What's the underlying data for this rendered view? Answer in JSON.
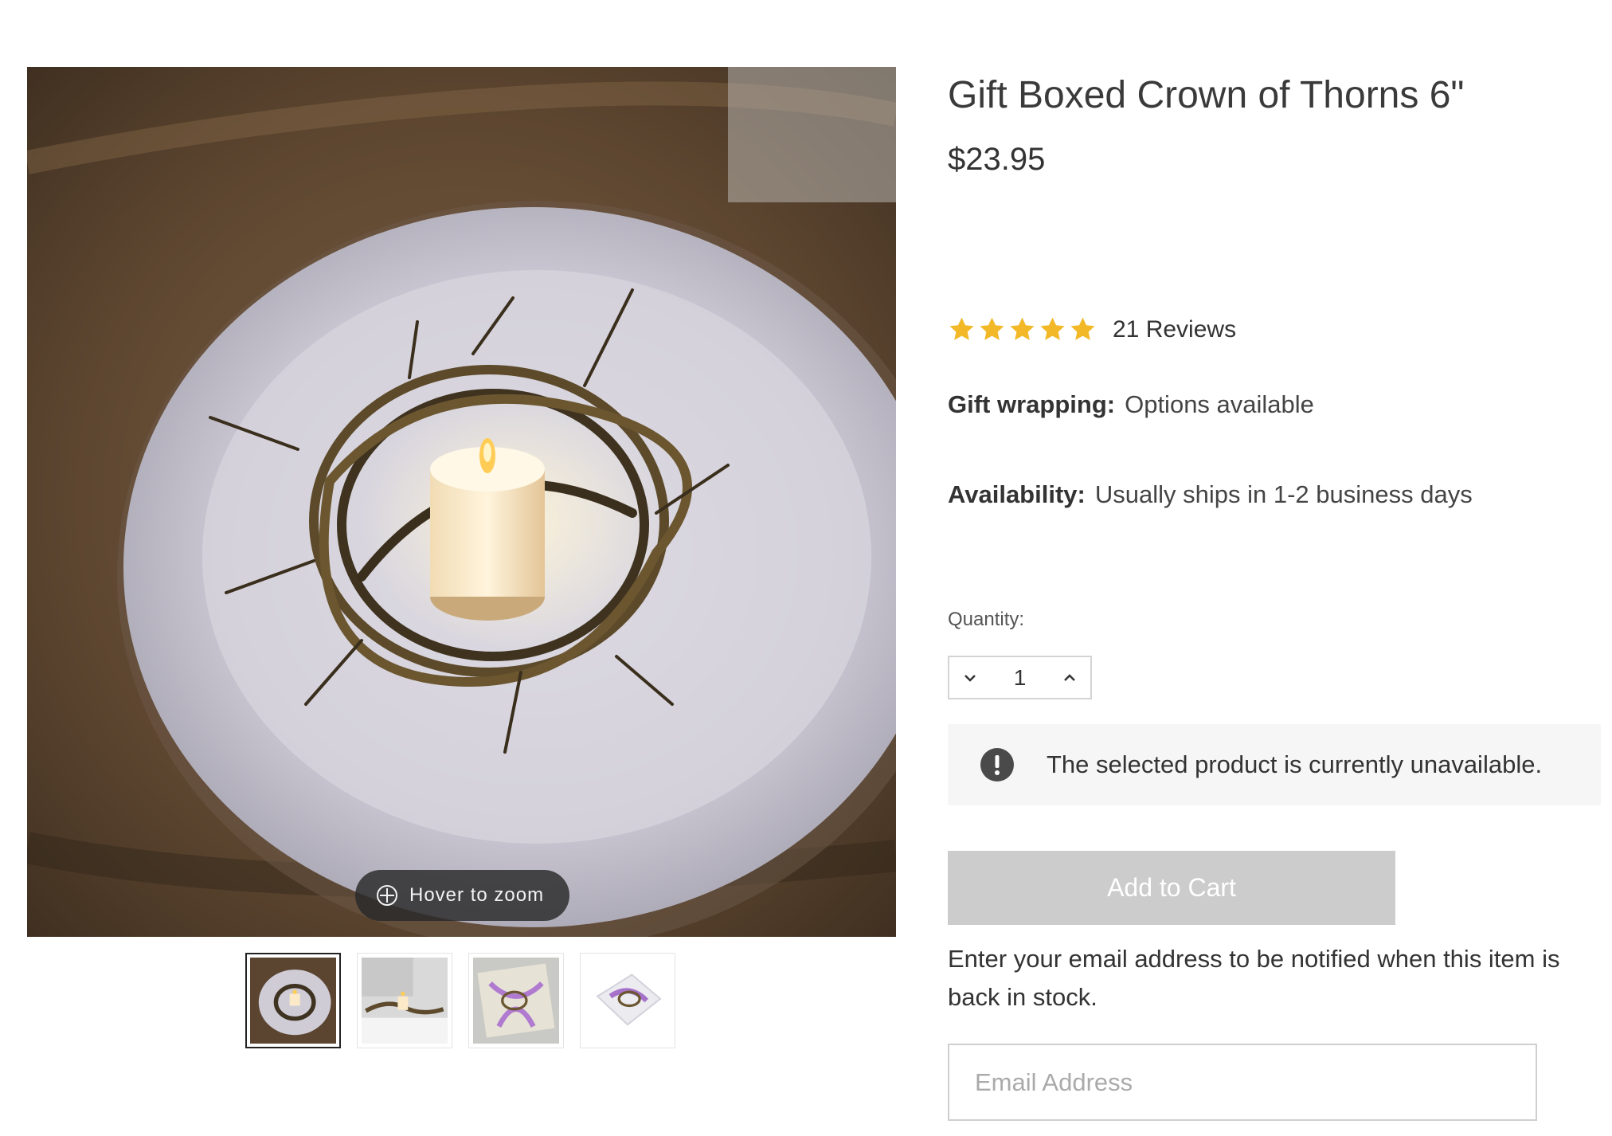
{
  "gallery": {
    "zoom_hint": "Hover to zoom",
    "thumbnails": [
      {
        "name": "thumbnail-bowl-candle",
        "active": true
      },
      {
        "name": "thumbnail-table-candle",
        "active": false
      },
      {
        "name": "thumbnail-gift-box-purple",
        "active": false
      },
      {
        "name": "thumbnail-gift-box-angled",
        "active": false
      }
    ]
  },
  "product": {
    "title": "Gift Boxed Crown of Thorns 6\"",
    "price": "$23.95",
    "rating": {
      "stars": 5,
      "max": 5,
      "reviews_label": "21 Reviews",
      "star_color": "#F2B827"
    },
    "gift_wrapping": {
      "label": "Gift wrapping:",
      "value": "Options available"
    },
    "availability": {
      "label": "Availability:",
      "value": "Usually ships in 1-2 business days"
    }
  },
  "quantity": {
    "label": "Quantity:",
    "value": "1",
    "decrement_icon": "chevron-down-icon",
    "increment_icon": "chevron-up-icon"
  },
  "alert": {
    "icon": "exclamation-icon",
    "text": "The selected product is currently unavailable."
  },
  "cart": {
    "label": "Add to Cart",
    "disabled": true,
    "bg": "#CCCCCC"
  },
  "notify": {
    "text": "Enter your email address to be notified when this item is back in stock.",
    "email_placeholder": "Email Address",
    "email_value": ""
  }
}
